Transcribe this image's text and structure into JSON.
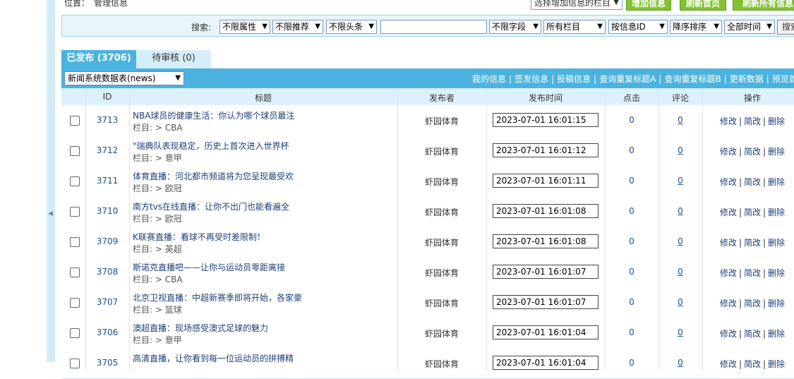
{
  "location": {
    "label": "位置：",
    "value": "管理信息"
  },
  "top_actions": {
    "column_select": "选择增加信息的栏目",
    "add_button": "增加信息",
    "refresh_home": "刷新首页",
    "refresh_all": "刷新所有信息"
  },
  "search": {
    "label": "搜索:",
    "filters": [
      "不限属性",
      "不限推荐",
      "不限头条"
    ],
    "keyword": "",
    "field": "不限字段",
    "column": "所有栏目",
    "sort_by": "按信息ID",
    "order": "降序排序",
    "time": "全部时间",
    "button": "搜索"
  },
  "tabs": [
    {
      "label": "已发布 (3706)"
    },
    {
      "label": "待审核 (0)"
    }
  ],
  "table_bar": {
    "db_select": "新闻系统数据表(news)",
    "links": [
      "我的信息",
      "签发信息",
      "投稿信息",
      "查询重复标题A",
      "查询重复标题B",
      "更新数据",
      "预览首"
    ]
  },
  "columns": {
    "id": "ID",
    "title": "标题",
    "publisher": "发布者",
    "time": "发布时间",
    "hits": "点击",
    "comments": "评论",
    "actions": "操作"
  },
  "row_actions": {
    "edit": "修改",
    "simple_edit": "简改",
    "delete": "删除"
  },
  "rows": [
    {
      "id": "3713",
      "title": "NBA球员的健康生活：你认为哪个球员最注",
      "category": "栏目: > CBA",
      "publisher": "虾园体育",
      "time": "2023-07-01 16:01:15",
      "hits": "0",
      "comments": "0"
    },
    {
      "id": "3712",
      "title": "\"瑞典队表现稳定，历史上首次进入世界杯",
      "category": "栏目: > 意甲",
      "publisher": "虾园体育",
      "time": "2023-07-01 16:01:12",
      "hits": "0",
      "comments": "0"
    },
    {
      "id": "3711",
      "title": "体育直播：河北都市频道将为您呈现最受欢",
      "category": "栏目: > 欧冠",
      "publisher": "虾园体育",
      "time": "2023-07-01 16:01:11",
      "hits": "0",
      "comments": "0"
    },
    {
      "id": "3710",
      "title": "南方tvs在线直播：让你不出门也能看遍全",
      "category": "栏目: > 欧冠",
      "publisher": "虾园体育",
      "time": "2023-07-01 16:01:08",
      "hits": "0",
      "comments": "0"
    },
    {
      "id": "3709",
      "title": "K联赛直播：看球不再受时差限制！",
      "category": "栏目: > 英超",
      "publisher": "虾园体育",
      "time": "2023-07-01 16:01:08",
      "hits": "0",
      "comments": "0"
    },
    {
      "id": "3708",
      "title": "斯诺克直播吧——让你与运动员零距离接",
      "category": "栏目: > CBA",
      "publisher": "虾园体育",
      "time": "2023-07-01 16:01:07",
      "hits": "0",
      "comments": "0"
    },
    {
      "id": "3707",
      "title": "北京卫视直播：中超新赛季即将开始，各家豪",
      "category": "栏目: > 篮球",
      "publisher": "虾园体育",
      "time": "2023-07-01 16:01:07",
      "hits": "0",
      "comments": "0"
    },
    {
      "id": "3706",
      "title": "澳超直播：现场感受澳式足球的魅力",
      "category": "栏目: > 意甲",
      "publisher": "虾园体育",
      "time": "2023-07-01 16:01:04",
      "hits": "0",
      "comments": "0"
    },
    {
      "id": "3705",
      "title": "高清直播，让你看到每一位运动员的拼搏精",
      "category": "",
      "publisher": "虾园体育",
      "time": "2023-07-01 16:01:04",
      "hits": "0",
      "comments": "0"
    }
  ]
}
